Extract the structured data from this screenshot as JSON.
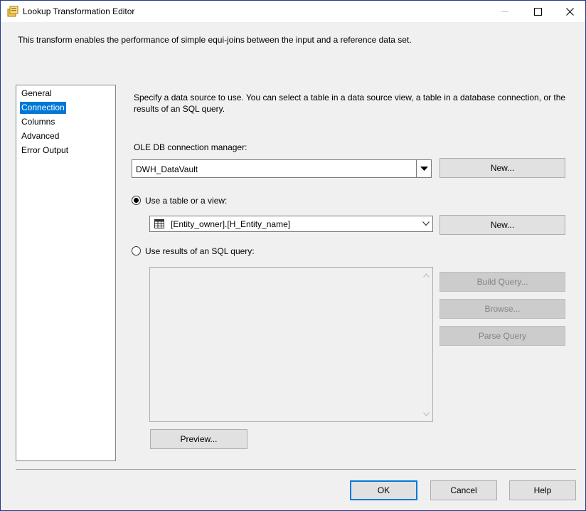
{
  "window": {
    "title": "Lookup Transformation Editor",
    "icon": "ssis-lookup-icon"
  },
  "description": "This transform enables the performance of simple equi-joins between the input and a reference data set.",
  "nav": {
    "items": [
      {
        "label": "General",
        "selected": false
      },
      {
        "label": "Connection",
        "selected": true
      },
      {
        "label": "Columns",
        "selected": false
      },
      {
        "label": "Advanced",
        "selected": false
      },
      {
        "label": "Error Output",
        "selected": false
      }
    ]
  },
  "connection": {
    "instruction": "Specify a data source to use. You can select a table in a data source view, a table in a database connection, or the results of an SQL query.",
    "oledb_label": "OLE DB connection manager:",
    "oledb_value": "DWH_DataVault",
    "oledb_new_button": "New...",
    "use_table_label": "Use a table or a view:",
    "use_table_selected": true,
    "table_value": "[Entity_owner].[H_Entity_name]",
    "table_new_button": "New...",
    "use_sql_label": "Use results of an SQL query:",
    "use_sql_selected": false,
    "sql_text": "",
    "build_query_button": "Build Query...",
    "browse_button": "Browse...",
    "parse_query_button": "Parse Query",
    "preview_button": "Preview..."
  },
  "footer": {
    "ok_button": "OK",
    "cancel_button": "Cancel",
    "help_button": "Help"
  },
  "colors": {
    "accent": "#0078d7",
    "window_border": "#1f3a8a",
    "disabled_text": "#838383"
  }
}
